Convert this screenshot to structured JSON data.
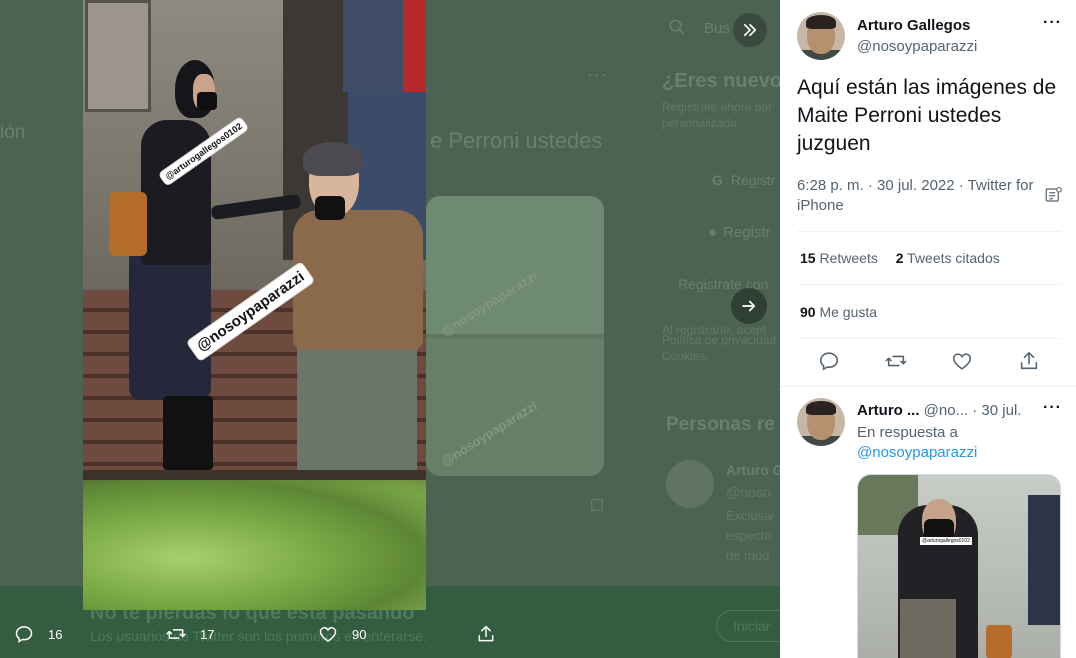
{
  "background": {
    "side_text": "ión",
    "main_title_fragment": "e Perroni ustedes",
    "search_placeholder": "Bus",
    "new_here_title": "¿Eres nuevo",
    "signup_text": [
      "Regístrate ahora par",
      "personalizada."
    ],
    "btn_google": "Registr",
    "btn_apple": "Registr",
    "btn_phone": "Registrate con",
    "legal_lines": [
      "Al registrarte, acept",
      "Política de privacidad",
      "Cookies."
    ],
    "watermark": "@nosoypaparazzi",
    "people_title": "Personas re",
    "person_name": "Arturo G",
    "person_handle": "@noso",
    "person_bio": "Exclusiv\nespecte\nde mod",
    "bottom_title": "No te pierdas lo que está pasando",
    "bottom_sub": "Los usuarios de Twitter son los primeros en enterarse.",
    "bottom_btn": "Iniciar"
  },
  "media": {
    "tag_small": "@arturogallegos0102",
    "tag_large": "@nosoypaparazzi",
    "actions": {
      "replies": "16",
      "retweets": "17",
      "likes": "90"
    }
  },
  "tweet": {
    "author_name": "Arturo Gallegos",
    "author_handle": "@nosoypaparazzi",
    "text": "Aquí están las imágenes de Maite Perroni ustedes juzguen",
    "meta": "6:28 p. m. · 30 jul. 2022 · Twitter for iPhone",
    "retweets_count": "15",
    "retweets_label": "Retweets",
    "quotes_count": "2",
    "quotes_label": "Tweets citados",
    "likes_count": "90",
    "likes_label": "Me gusta"
  },
  "reply": {
    "author_name": "Arturo ...",
    "author_handle": "@no...",
    "date": "· 30 jul.",
    "in_reply_prefix": "En respuesta a",
    "in_reply_handle": "@nosoypaparazzi",
    "image_tag": "@arturogallegos0102"
  },
  "colors": {
    "accent": "#1d9bf0",
    "text_primary": "#0f1419",
    "text_secondary": "#536471"
  }
}
